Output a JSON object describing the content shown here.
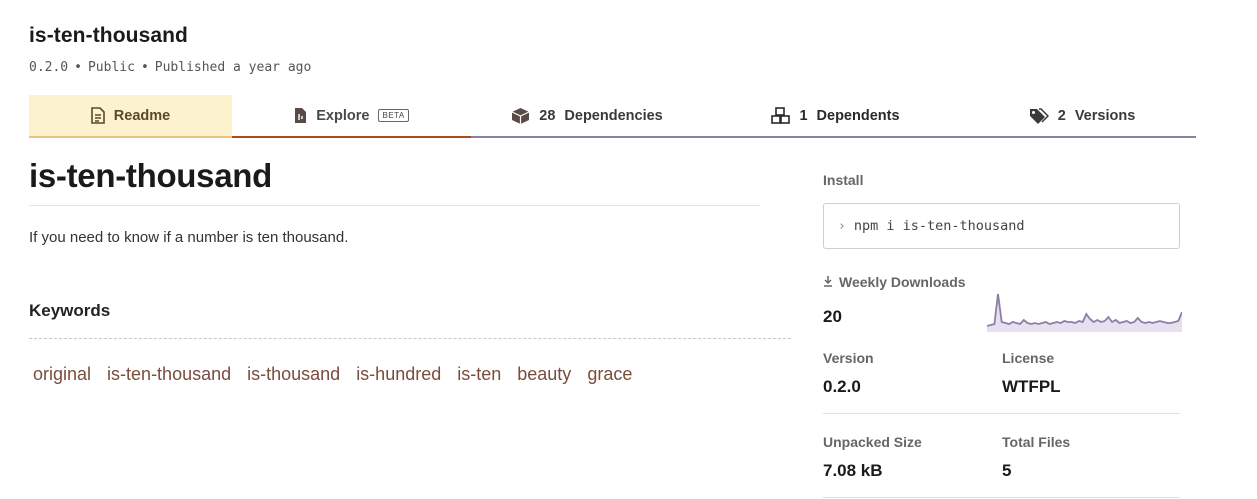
{
  "package": {
    "name": "is-ten-thousand",
    "version_meta": "0.2.0",
    "visibility": "Public",
    "published": "Published a year ago"
  },
  "tabs": {
    "readme": "Readme",
    "explore": "Explore",
    "explore_badge": "BETA",
    "dependencies_count": "28",
    "dependencies": "Dependencies",
    "dependents_count": "1",
    "dependents": "Dependents",
    "versions_count": "2",
    "versions": "Versions"
  },
  "readme": {
    "title": "is-ten-thousand",
    "description": "If you need to know if a number is ten thousand.",
    "keywords_heading": "Keywords",
    "keywords": [
      "original",
      "is-ten-thousand",
      "is-thousand",
      "is-hundred",
      "is-ten",
      "beauty",
      "grace"
    ]
  },
  "sidebar": {
    "install_label": "Install",
    "install_command": "npm i is-ten-thousand",
    "weekly_label": "Weekly Downloads",
    "weekly_value": "20",
    "weekly_trend": [
      4,
      5,
      6,
      36,
      8,
      7,
      6,
      8,
      7,
      6,
      10,
      7,
      6,
      7,
      6,
      7,
      8,
      6,
      7,
      8,
      7,
      9,
      8,
      8,
      7,
      9,
      8,
      16,
      11,
      8,
      10,
      8,
      9,
      13,
      8,
      10,
      7,
      8,
      9,
      7,
      8,
      12,
      8,
      7,
      8,
      7,
      8,
      9,
      8,
      7,
      7,
      8,
      9,
      18
    ],
    "version_label": "Version",
    "version_value": "0.2.0",
    "license_label": "License",
    "license_value": "WTFPL",
    "unpacked_label": "Unpacked Size",
    "unpacked_value": "7.08 kB",
    "files_label": "Total Files",
    "files_value": "5"
  },
  "colors": {
    "readme_tab_bg": "#fdf2ce",
    "keyword": "#7a4c3c",
    "sparkline_stroke": "#8b7fa8",
    "sparkline_fill": "#e6e1ee"
  }
}
